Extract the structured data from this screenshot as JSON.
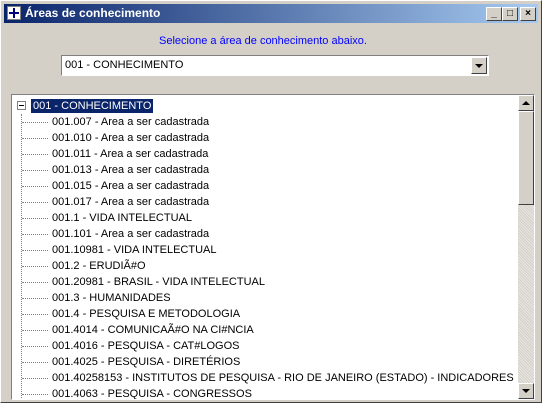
{
  "window": {
    "title": "Áreas de conhecimento",
    "minimize_glyph": "_",
    "maximize_glyph": "□",
    "close_glyph": "×"
  },
  "prompt": "Selecione a área de conhecimento abaixo.",
  "combo": {
    "value": "001 - CONHECIMENTO"
  },
  "tree": {
    "root_label": "001 - CONHECIMENTO",
    "items": [
      "001.007 - Area a ser cadastrada",
      "001.010 - Area a ser cadastrada",
      "001.011 - Area a ser cadastrada",
      "001.013 - Area a ser cadastrada",
      "001.015 - Area a ser cadastrada",
      "001.017 - Area a ser cadastrada",
      "001.1 - VIDA INTELECTUAL",
      "001.101 - Area a ser cadastrada",
      "001.10981 - VIDA INTELECTUAL",
      "001.2 - ERUDIÃ#O",
      "001.20981 - BRASIL - VIDA INTELECTUAL",
      "001.3 - HUMANIDADES",
      "001.4 - PESQUISA E METODOLOGIA",
      "001.4014 - COMUNICAÃ#O NA CI#NCIA",
      "001.4016 - PESQUISA - CAT#LOGOS",
      "001.4025 - PESQUISA - DIRETÉRIOS",
      "001.40258153 - INSTITUTOS DE PESQUISA - RIO DE JANEIRO (ESTADO) - INDICADORES",
      "001.4063 - PESQUISA - CONGRESSOS"
    ]
  }
}
